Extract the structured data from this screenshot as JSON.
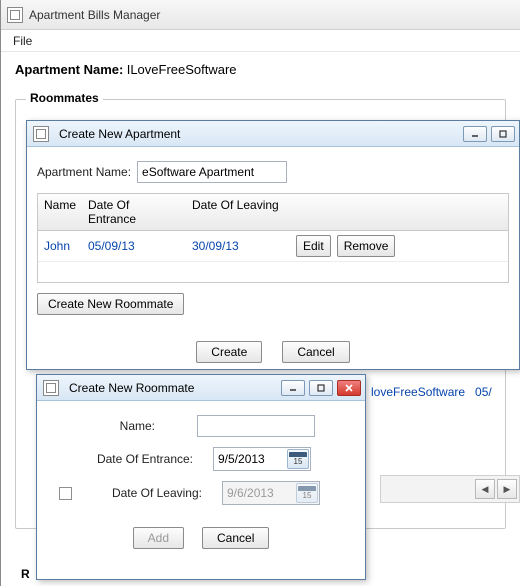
{
  "window": {
    "title": "Apartment Bills Manager"
  },
  "menu": {
    "file": "File"
  },
  "main": {
    "apartment_label": "Apartment Name:",
    "apartment_value": "ILoveFreeSoftware",
    "roommates_legend": "Roommates",
    "bottom_r": "R"
  },
  "create_apt": {
    "title": "Create New Apartment",
    "apartment_label": "Apartment Name:",
    "apartment_value": "eSoftware Apartment",
    "cols": {
      "name": "Name",
      "entrance": "Date Of Entrance",
      "leaving": "Date Of Leaving"
    },
    "row": {
      "name": "John",
      "entrance": "05/09/13",
      "leaving": "30/09/13",
      "edit": "Edit",
      "remove": "Remove"
    },
    "create_roommate": "Create New Roommate",
    "create": "Create",
    "cancel": "Cancel"
  },
  "bg_row": {
    "name": "loveFreeSoftware",
    "date": "05/"
  },
  "create_rm": {
    "title": "Create New Roommate",
    "name_label": "Name:",
    "name_value": "",
    "entrance_label": "Date Of Entrance:",
    "entrance_value": "9/5/2013",
    "leaving_label": "Date Of Leaving:",
    "leaving_value": "9/6/2013",
    "cal_day": "15",
    "add": "Add",
    "cancel": "Cancel"
  }
}
